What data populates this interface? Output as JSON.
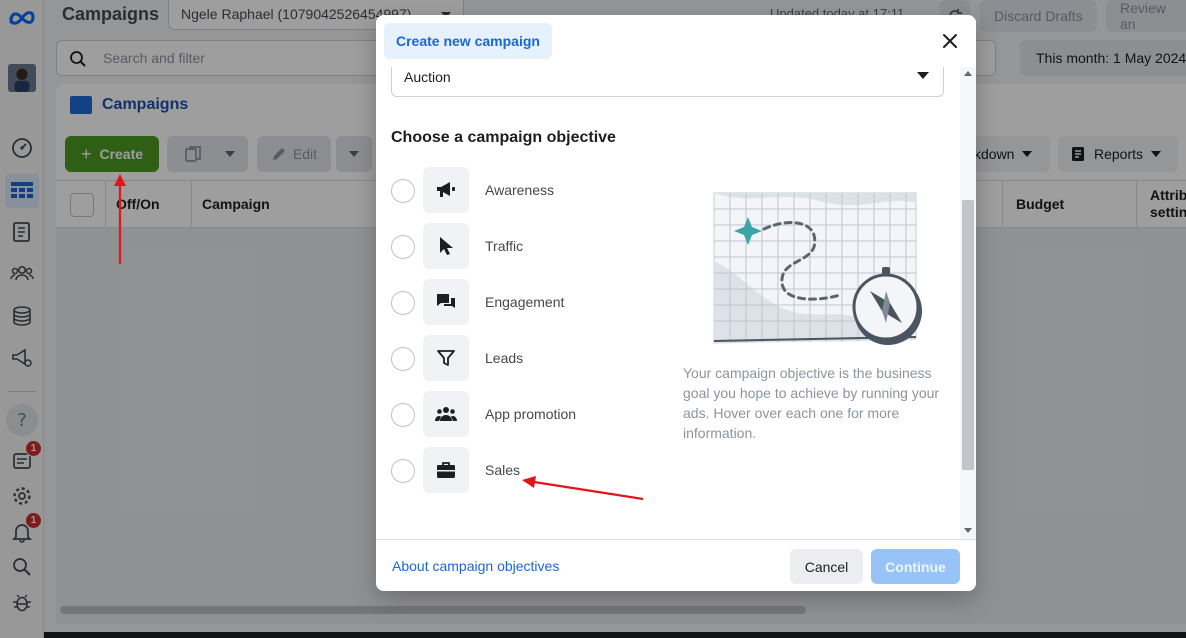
{
  "header": {
    "title": "Campaigns",
    "account": "Ngele Raphael (1079042526454997)",
    "updated": "Updated today at 17:11",
    "discard_drafts": "Discard Drafts",
    "review": "Review an"
  },
  "search": {
    "placeholder": "Search and filter"
  },
  "date_range": "This month: 1 May 2024",
  "tab": {
    "label": "Campaigns"
  },
  "toolbar": {
    "create": "Create",
    "edit": "Edit",
    "breakdown": "kdown",
    "reports": "Reports"
  },
  "table": {
    "headers": {
      "off_on": "Off/On",
      "campaign": "Campaign",
      "budget": "Budget",
      "attribution_1": "Attrib",
      "attribution_2": "setting"
    }
  },
  "rail": {
    "notification_badge": "1",
    "alerts_badge": "1"
  },
  "modal": {
    "title": "Create new campaign",
    "buying_type": "Auction",
    "section_title": "Choose a campaign objective",
    "objectives": [
      {
        "label": "Awareness",
        "icon": "megaphone-icon"
      },
      {
        "label": "Traffic",
        "icon": "cursor-icon"
      },
      {
        "label": "Engagement",
        "icon": "chat-bubbles-icon"
      },
      {
        "label": "Leads",
        "icon": "funnel-icon"
      },
      {
        "label": "App promotion",
        "icon": "people-icon"
      },
      {
        "label": "Sales",
        "icon": "shopping-bag-icon"
      }
    ],
    "description": "Your campaign objective is the business goal you hope to achieve by running your ads. Hover over each one for more information.",
    "about_link": "About campaign objectives",
    "cancel": "Cancel",
    "continue": "Continue"
  },
  "colors": {
    "accent_blue": "#1b67d4",
    "create_green": "#4b9a23",
    "annotation_red": "#e3141a",
    "continue_disabled": "#97c3f7"
  }
}
